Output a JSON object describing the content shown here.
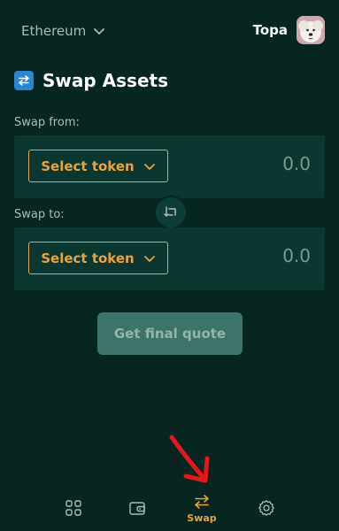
{
  "header": {
    "network_label": "Ethereum",
    "account_name": "Topa"
  },
  "page": {
    "title": "Swap Assets"
  },
  "swap_from": {
    "label": "Swap from:",
    "token_button_label": "Select token",
    "amount": "0.0"
  },
  "swap_to": {
    "label": "Swap to:",
    "token_button_label": "Select token",
    "amount": "0.0"
  },
  "actions": {
    "get_quote_label": "Get final quote"
  },
  "bottom_nav": {
    "items": [
      {
        "icon": "grid-icon",
        "label": ""
      },
      {
        "icon": "wallet-icon",
        "label": ""
      },
      {
        "icon": "swap-arrows-icon",
        "label": "Swap",
        "active": true
      },
      {
        "icon": "gear-icon",
        "label": ""
      }
    ]
  },
  "colors": {
    "background": "#072621",
    "card": "#0b3731",
    "accent": "#e9a33a",
    "muted_text": "#a9beb8",
    "disabled_button": "#3c7469",
    "title_icon": "#2a86d0"
  }
}
